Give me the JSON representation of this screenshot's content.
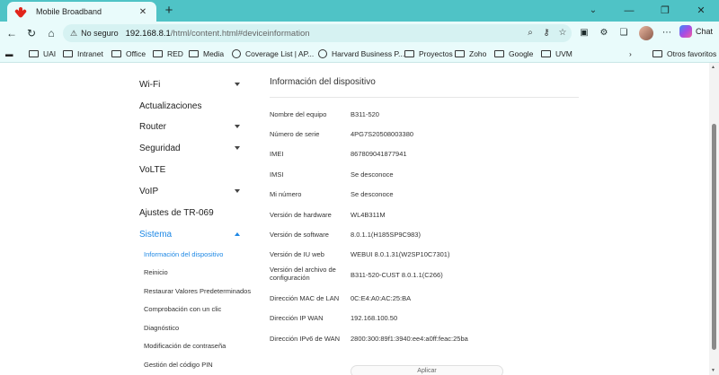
{
  "browser": {
    "tab_title": "Mobile Broadband",
    "tab_close": "✕",
    "new_tab": "+",
    "address": {
      "security_label": "No seguro",
      "host": "192.168.8.1",
      "path": "/html/content.html#deviceinformation"
    },
    "chat_label": "Chat"
  },
  "bookmarks": [
    {
      "label": "UAI",
      "type": "folder"
    },
    {
      "label": "Intranet",
      "type": "folder"
    },
    {
      "label": "Office",
      "type": "folder"
    },
    {
      "label": "RED",
      "type": "folder"
    },
    {
      "label": "Media",
      "type": "folder"
    },
    {
      "label": "Coverage List | AP...",
      "type": "site"
    },
    {
      "label": "Harvard Business P...",
      "type": "site"
    },
    {
      "label": "Proyectos",
      "type": "folder"
    },
    {
      "label": "Zoho",
      "type": "folder"
    },
    {
      "label": "Google",
      "type": "folder"
    },
    {
      "label": "UVM",
      "type": "folder"
    }
  ],
  "other_bookmarks": "Otros favoritos",
  "sidebar": {
    "items": [
      {
        "label": "Wi-Fi",
        "caret": true
      },
      {
        "label": "Actualizaciones",
        "caret": false
      },
      {
        "label": "Router",
        "caret": true
      },
      {
        "label": "Seguridad",
        "caret": true
      },
      {
        "label": "VoLTE",
        "caret": false
      },
      {
        "label": "VoIP",
        "caret": true
      },
      {
        "label": "Ajustes de TR-069",
        "caret": false
      },
      {
        "label": "Sistema",
        "caret": true,
        "active": true
      }
    ],
    "sub_items": [
      {
        "label": "Información del dispositivo",
        "active": true
      },
      {
        "label": "Reinicio"
      },
      {
        "label": "Restaurar Valores Predeterminados"
      },
      {
        "label": "Comprobación con un clic"
      },
      {
        "label": "Diagnóstico"
      },
      {
        "label": "Modificación de contraseña"
      },
      {
        "label": "Gestión del código PIN"
      }
    ]
  },
  "main": {
    "title": "Información del dispositivo",
    "rows": [
      {
        "label": "Nombre del equipo",
        "value": "B311-520"
      },
      {
        "label": "Número de serie",
        "value": "4PG7S20508003380"
      },
      {
        "label": "IMEI",
        "value": "867809041877941"
      },
      {
        "label": "IMSI",
        "value": "Se desconoce"
      },
      {
        "label": "Mi número",
        "value": "Se desconoce"
      },
      {
        "label": "Versión de hardware",
        "value": "WL4B311M"
      },
      {
        "label": "Versión de software",
        "value": "8.0.1.1(H185SP9C983)"
      },
      {
        "label": "Versión de IU web",
        "value": "WEBUI 8.0.1.31(W2SP10C7301)"
      },
      {
        "label": "Versión del archivo de configuración",
        "value": "B311-520-CUST 8.0.1.1(C266)"
      },
      {
        "label": "Dirección MAC de LAN",
        "value": "0C:E4:A0:AC:25:BA"
      },
      {
        "label": "Dirección IP WAN",
        "value": "192.168.100.50"
      },
      {
        "label": "Dirección IPv6 de WAN",
        "value": "2800:300:89f1:3940:ee4:a0ff:feac:25ba"
      }
    ],
    "apply_label": "Aplicar"
  },
  "colors": {
    "accent": "#1e88e5",
    "frame": "#4fc3c6",
    "brand": "#e1251b"
  }
}
